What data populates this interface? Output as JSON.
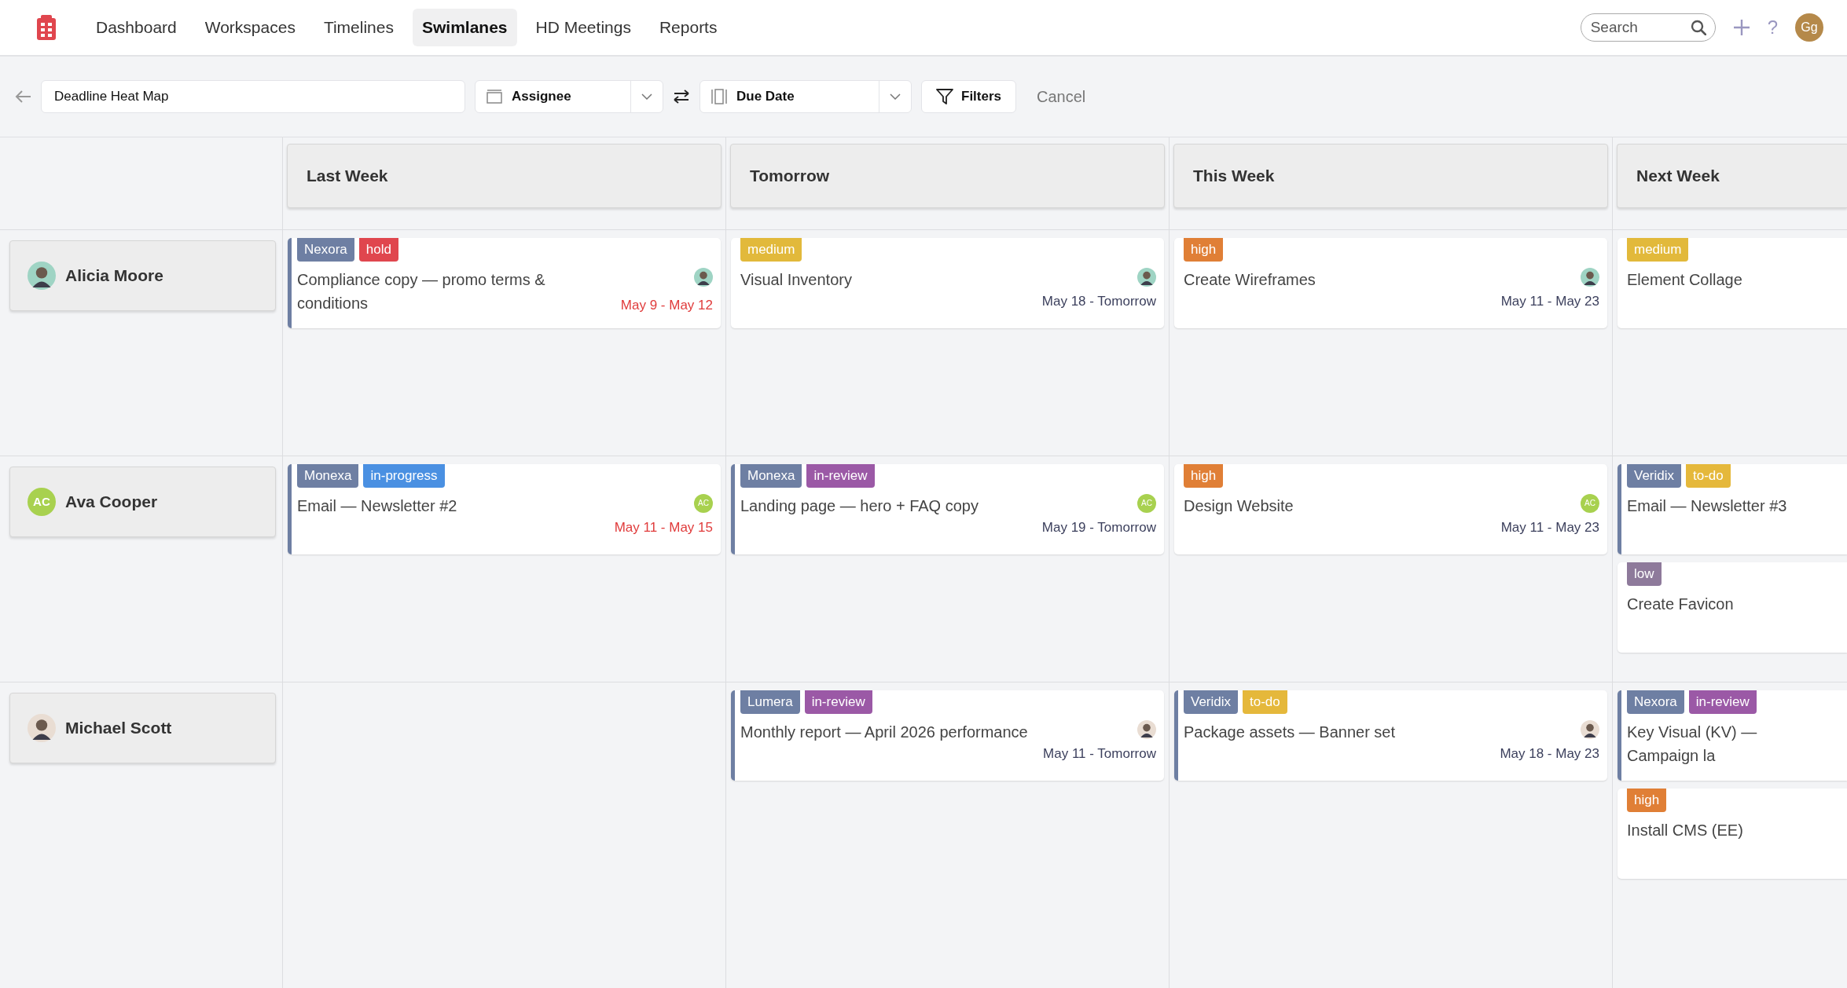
{
  "nav": {
    "items": [
      {
        "label": "Dashboard",
        "selected": false
      },
      {
        "label": "Workspaces",
        "selected": false
      },
      {
        "label": "Timelines",
        "selected": false
      },
      {
        "label": "Swimlanes",
        "selected": true
      },
      {
        "label": "HD Meetings",
        "selected": false
      },
      {
        "label": "Reports",
        "selected": false
      }
    ],
    "search": {
      "placeholder": "Search"
    },
    "help": "?",
    "user": {
      "initials": "Gg",
      "color": "#b5894a"
    }
  },
  "toolbar": {
    "title": "Deadline Heat Map",
    "row_field": "Assignee",
    "column_field": "Due Date",
    "filters": "Filters",
    "cancel": "Cancel"
  },
  "columns": [
    "Last Week",
    "Tomorrow",
    "This Week",
    "Next Week"
  ],
  "lanes": [
    {
      "name": "Alicia Moore",
      "avatar": {
        "kind": "photo",
        "color": "#9fd4c4"
      },
      "cells": [
        [
          {
            "tags": [
              {
                "label": "Nexora",
                "color": "#6e7fa3"
              },
              {
                "label": "hold",
                "color": "#e0464e"
              }
            ],
            "title": "Compliance copy — promo terms & conditions",
            "accent": true,
            "avatar": {
              "kind": "photo",
              "color": "#9fd4c4"
            },
            "date": "May 9 - May 12",
            "overdue": true
          }
        ],
        [
          {
            "tags": [
              {
                "label": "medium",
                "color": "#e2b93b"
              }
            ],
            "title": "Visual Inventory",
            "accent": false,
            "avatar": {
              "kind": "photo",
              "color": "#9fd4c4"
            },
            "date": "May 18 - Tomorrow",
            "overdue": false
          }
        ],
        [
          {
            "tags": [
              {
                "label": "high",
                "color": "#e07f36"
              }
            ],
            "title": "Create Wireframes",
            "accent": false,
            "avatar": {
              "kind": "photo",
              "color": "#9fd4c4"
            },
            "date": "May 11 - May 23",
            "overdue": false
          }
        ],
        [
          {
            "tags": [
              {
                "label": "medium",
                "color": "#e2b93b"
              }
            ],
            "title": "Element Collage",
            "accent": false
          }
        ]
      ]
    },
    {
      "name": "Ava Cooper",
      "avatar": {
        "kind": "initials",
        "text": "AC",
        "color": "#a8d14f"
      },
      "cells": [
        [
          {
            "tags": [
              {
                "label": "Monexa",
                "color": "#6e7fa3"
              },
              {
                "label": "in-progress",
                "color": "#4a90e2"
              }
            ],
            "title": "Email — Newsletter #2",
            "accent": true,
            "avatar": {
              "kind": "initials",
              "text": "AC",
              "color": "#a8d14f"
            },
            "date": "May 11 - May 15",
            "overdue": true
          }
        ],
        [
          {
            "tags": [
              {
                "label": "Monexa",
                "color": "#6e7fa3"
              },
              {
                "label": "in-review",
                "color": "#9b59a6"
              }
            ],
            "title": "Landing page — hero + FAQ copy",
            "accent": true,
            "avatar": {
              "kind": "initials",
              "text": "AC",
              "color": "#a8d14f"
            },
            "date": "May 19 - Tomorrow",
            "overdue": false
          }
        ],
        [
          {
            "tags": [
              {
                "label": "high",
                "color": "#e07f36"
              }
            ],
            "title": "Design Website",
            "accent": false,
            "avatar": {
              "kind": "initials",
              "text": "AC",
              "color": "#a8d14f"
            },
            "date": "May 11 - May 23",
            "overdue": false
          }
        ],
        [
          {
            "tags": [
              {
                "label": "Veridix",
                "color": "#6e7fa3"
              },
              {
                "label": "to-do",
                "color": "#e5b83b"
              }
            ],
            "title": "Email — Newsletter #3",
            "accent": true
          },
          {
            "tags": [
              {
                "label": "low",
                "color": "#8e7a9b"
              }
            ],
            "title": "Create Favicon",
            "accent": false
          }
        ]
      ]
    },
    {
      "name": "Michael Scott",
      "avatar": {
        "kind": "photo",
        "color": "#e9ddd3"
      },
      "cells": [
        [],
        [
          {
            "tags": [
              {
                "label": "Lumera",
                "color": "#6e7fa3"
              },
              {
                "label": "in-review",
                "color": "#9b59a6"
              }
            ],
            "title": "Monthly report — April 2026 performance",
            "accent": true,
            "avatar": {
              "kind": "photo",
              "color": "#e9ddd3"
            },
            "date": "May 11 - Tomorrow",
            "overdue": false
          }
        ],
        [
          {
            "tags": [
              {
                "label": "Veridix",
                "color": "#6e7fa3"
              },
              {
                "label": "to-do",
                "color": "#e5b83b"
              }
            ],
            "title": "Package assets — Banner set",
            "accent": true,
            "avatar": {
              "kind": "photo",
              "color": "#e9ddd3"
            },
            "date": "May 18 - May 23",
            "overdue": false
          }
        ],
        [
          {
            "tags": [
              {
                "label": "Nexora",
                "color": "#6e7fa3"
              },
              {
                "label": "in-review",
                "color": "#9b59a6"
              }
            ],
            "title": "Key Visual (KV) — Campaign la",
            "accent": true
          },
          {
            "tags": [
              {
                "label": "high",
                "color": "#e07f36"
              }
            ],
            "title": "Install CMS (EE)",
            "accent": false
          }
        ]
      ]
    }
  ]
}
